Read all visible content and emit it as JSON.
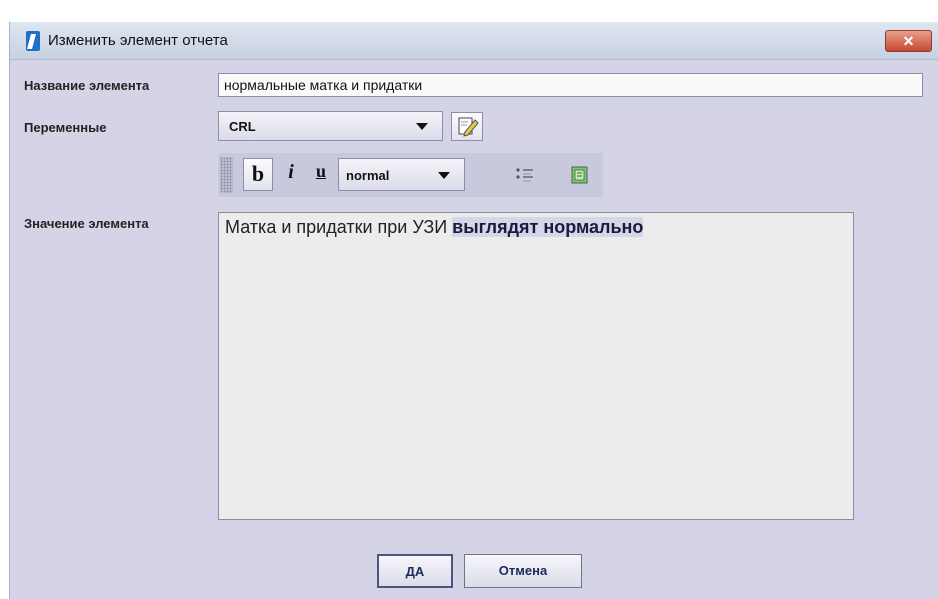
{
  "window": {
    "title": "Изменить элемент отчета",
    "close_glyph": "✕"
  },
  "form": {
    "name_label": "Название элемента",
    "name_value": "нормальные матка и придатки",
    "variables_label": "Переменные",
    "variables_selected": "CRL",
    "value_label": "Значение элемента",
    "value_text_plain": "Матка и придатки при УЗИ ",
    "value_text_bold": "выглядят нормально"
  },
  "toolbar": {
    "bold_label": "b",
    "italic_label": "i",
    "underline_label": "u",
    "style_selected": "normal"
  },
  "buttons": {
    "ok_label": "ДА",
    "cancel_label": "Отмена"
  },
  "icons": {
    "app": "document-icon",
    "edit": "edit-pencil-icon",
    "list": "bulleted-list-icon",
    "insert": "insert-field-icon"
  },
  "colors": {
    "dialog_bg": "#d4d4e6",
    "close_button": "#c54a33",
    "highlight": "#d6d6ea"
  }
}
